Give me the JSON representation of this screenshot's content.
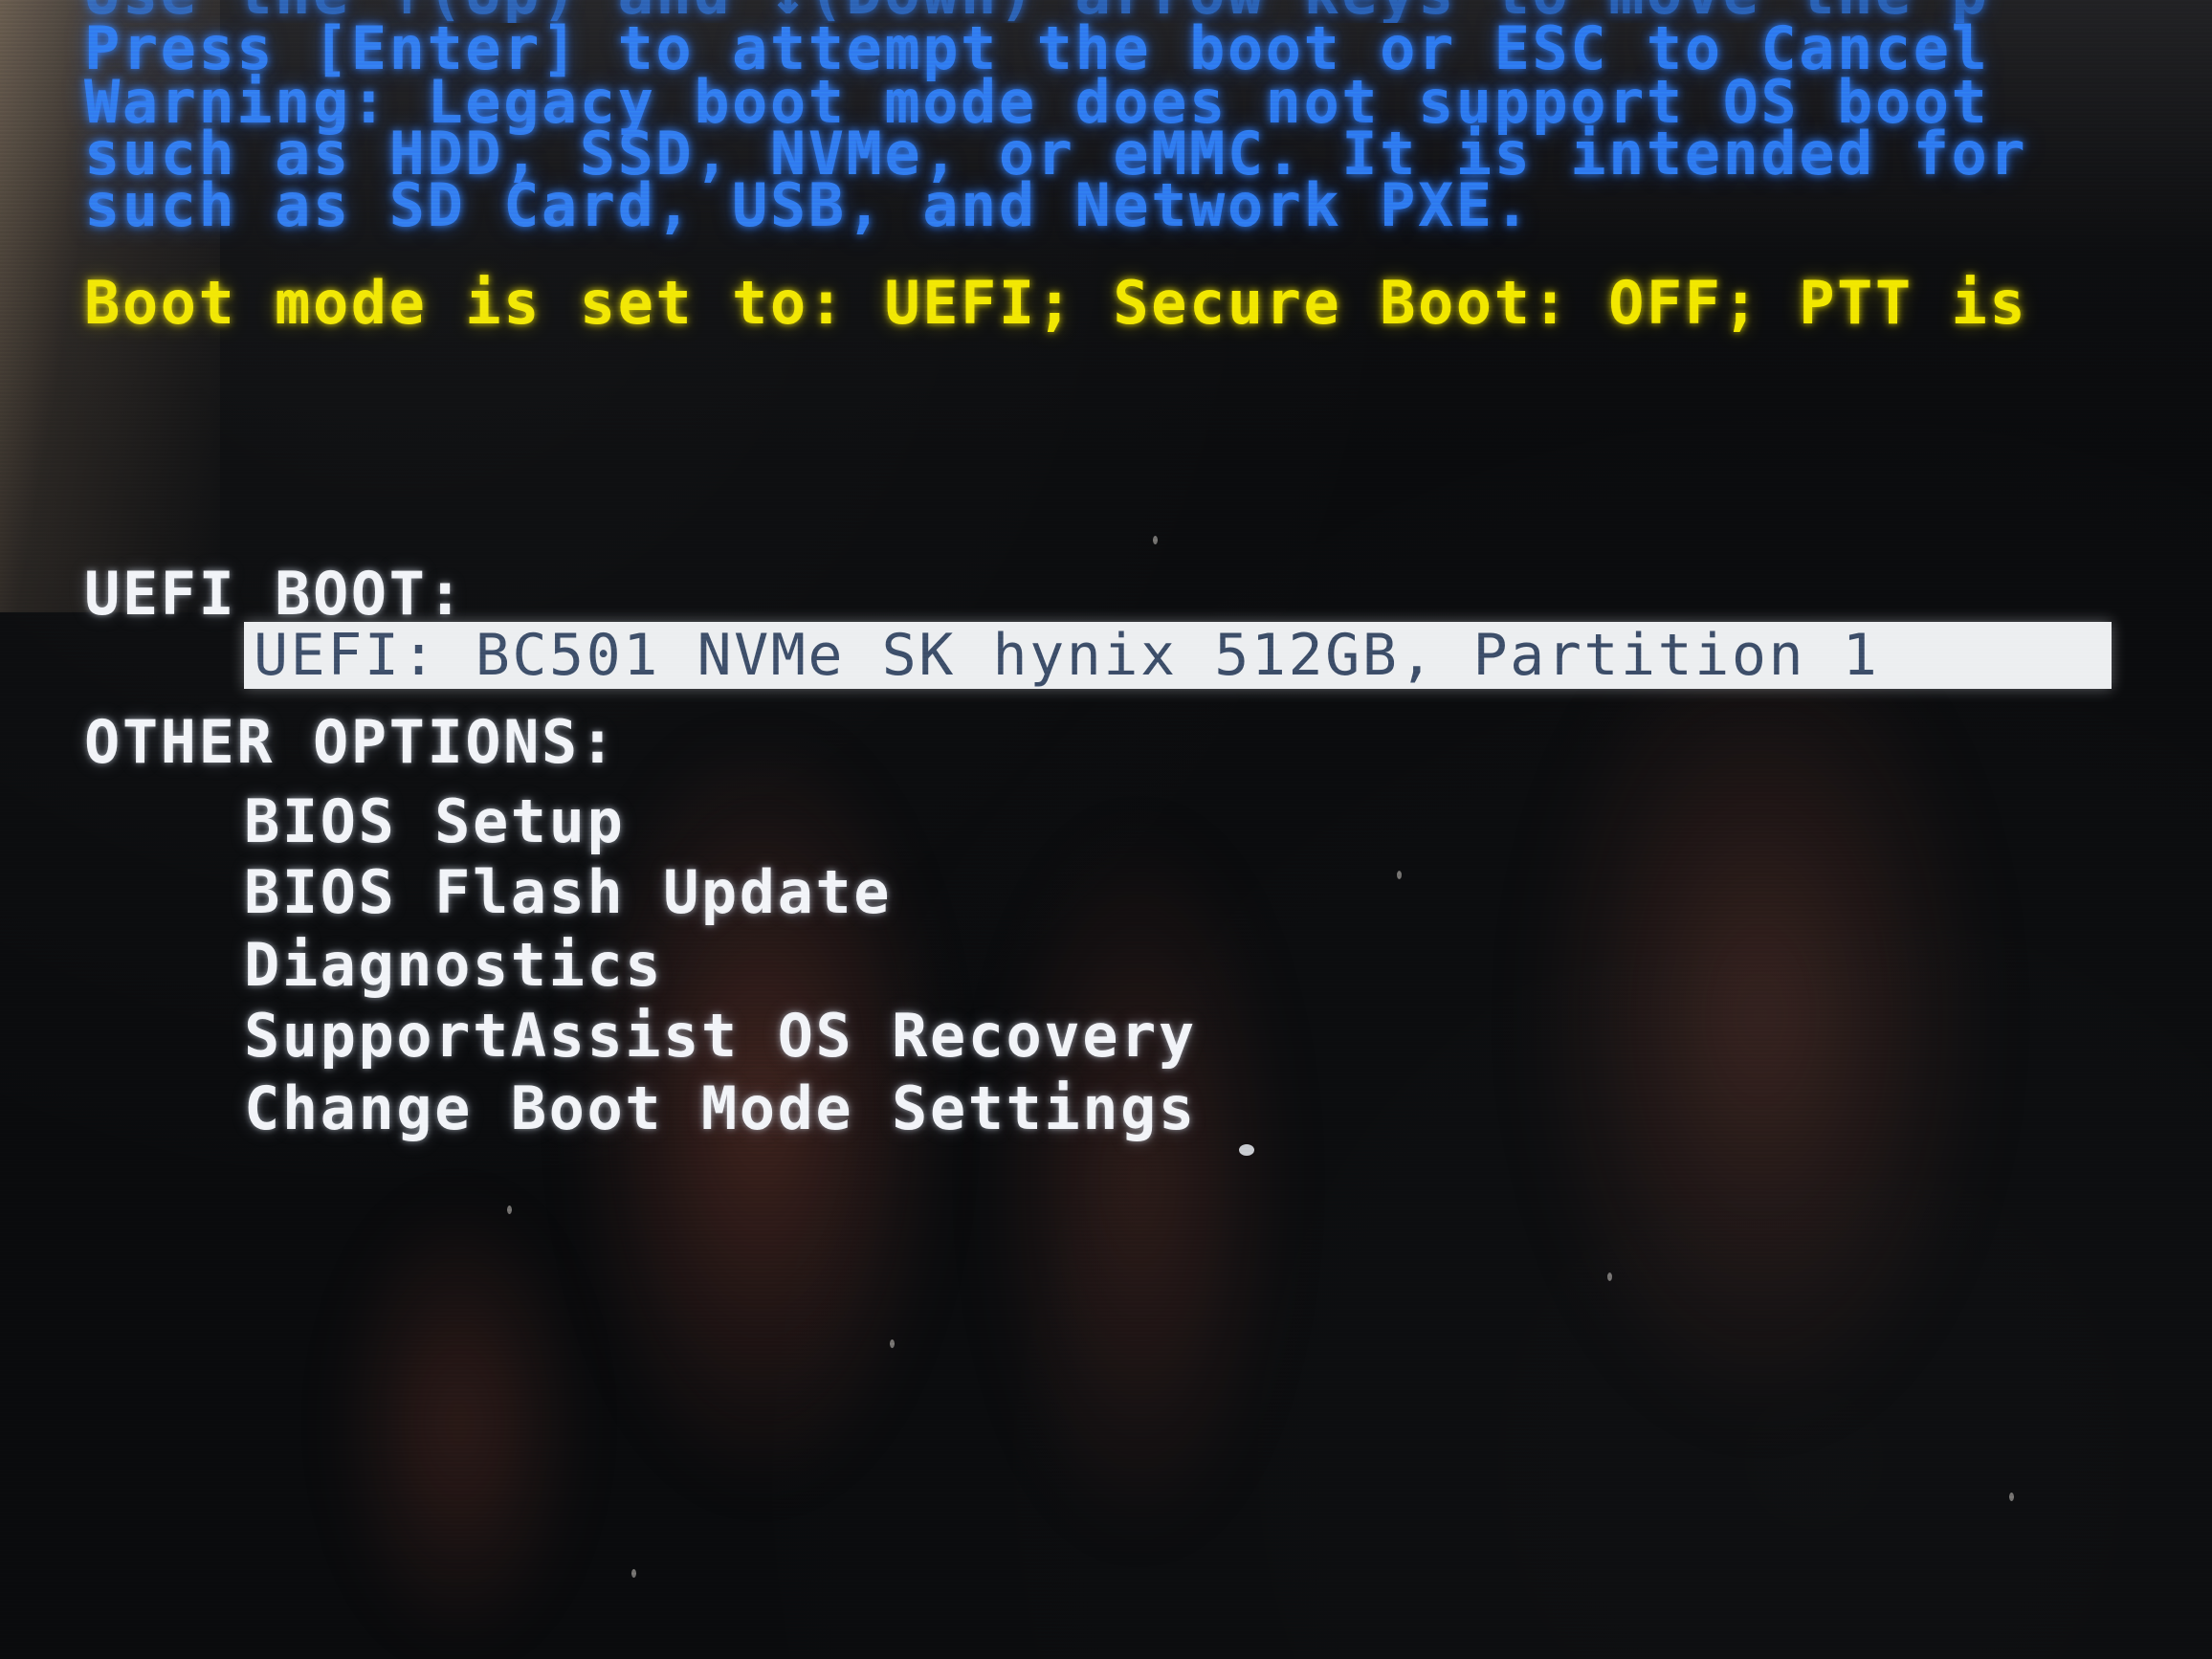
{
  "screen": {
    "kind": "dell-f12-one-time-boot-menu",
    "colors": {
      "background": "#0a0b0d",
      "instruction_blue": "#2f7ef0",
      "status_yellow": "#f2e800",
      "option_white": "#f2f4f8",
      "selection_background": "#edeff1",
      "selection_text": "#3d4f6b"
    }
  },
  "instructions": {
    "line_1": "Use the ↑(Up) and ↓(Down) arrow keys to move the p",
    "line_2": "Press [Enter] to attempt the boot or ESC to Cancel",
    "line_3": "Warning: Legacy boot mode does not support OS boot",
    "line_4": "such as HDD, SSD, NVMe, or eMMC. It is intended for",
    "line_5": "such as SD Card, USB, and Network PXE."
  },
  "status": {
    "line": "Boot mode is set to: UEFI; Secure Boot: OFF; PTT is"
  },
  "uefi_boot": {
    "header": "UEFI BOOT:",
    "entries": [
      {
        "label": "UEFI: BC501 NVMe SK hynix 512GB, Partition 1",
        "selected": true
      }
    ]
  },
  "other_options": {
    "header": "OTHER OPTIONS:",
    "items": [
      {
        "label": "BIOS Setup"
      },
      {
        "label": "BIOS Flash Update"
      },
      {
        "label": "Diagnostics"
      },
      {
        "label": "SupportAssist OS Recovery"
      },
      {
        "label": "Change Boot Mode Settings"
      }
    ]
  }
}
